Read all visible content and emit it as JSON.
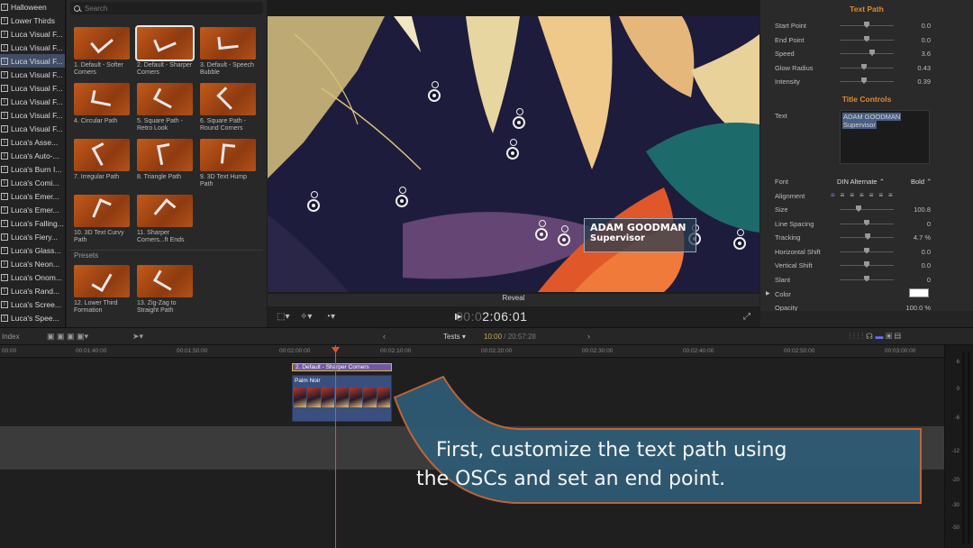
{
  "sidebar": {
    "items": [
      {
        "label": "Halloween",
        "selected": false
      },
      {
        "label": "Lower Thirds",
        "selected": false
      },
      {
        "label": "Luca Visual F...",
        "selected": false
      },
      {
        "label": "Luca Visual F...",
        "selected": false
      },
      {
        "label": "Luca Visual F...",
        "selected": true
      },
      {
        "label": "Luca Visual F...",
        "selected": false
      },
      {
        "label": "Luca Visual F...",
        "selected": false
      },
      {
        "label": "Luca Visual F...",
        "selected": false
      },
      {
        "label": "Luca Visual F...",
        "selected": false
      },
      {
        "label": "Luca Visual F...",
        "selected": false
      },
      {
        "label": "Luca's Asse...",
        "selected": false
      },
      {
        "label": "Luca's Auto-...",
        "selected": false
      },
      {
        "label": "Luca's Burn I...",
        "selected": false
      },
      {
        "label": "Luca's Comi...",
        "selected": false
      },
      {
        "label": "Luca's Emer...",
        "selected": false
      },
      {
        "label": "Luca's Emer...",
        "selected": false
      },
      {
        "label": "Luca's Falling...",
        "selected": false
      },
      {
        "label": "Luca's Fiery...",
        "selected": false
      },
      {
        "label": "Luca's Glass...",
        "selected": false
      },
      {
        "label": "Luca's Neon...",
        "selected": false
      },
      {
        "label": "Luca's Onom...",
        "selected": false
      },
      {
        "label": "Luca's Rand...",
        "selected": false
      },
      {
        "label": "Luca's Scree...",
        "selected": false
      },
      {
        "label": "Luca's Spee...",
        "selected": false
      }
    ]
  },
  "browser": {
    "search_placeholder": "Search",
    "tiles": [
      {
        "caption": "1. Default - Softer Corners",
        "selected": false
      },
      {
        "caption": "2. Default - Sharper Corners",
        "selected": true
      },
      {
        "caption": "3. Default - Speech Bubble",
        "selected": false
      },
      {
        "caption": "4. Circular Path",
        "selected": false
      },
      {
        "caption": "5. Square Path - Retro Look",
        "selected": false
      },
      {
        "caption": "6. Square Path - Round Corners",
        "selected": false
      },
      {
        "caption": "7. Irregular Path",
        "selected": false
      },
      {
        "caption": "8. Triangle Path",
        "selected": false
      },
      {
        "caption": "9. 3D Text Hump Path",
        "selected": false
      },
      {
        "caption": "10. 3D Text Curvy Path",
        "selected": false
      },
      {
        "caption": "11. Sharper Corners...ft Ends",
        "selected": false
      }
    ],
    "presets_label": "Presets",
    "preset_tiles": [
      {
        "caption": "12. Lower Third Formation"
      },
      {
        "caption": "13. Zig-Zag to Straight Path"
      }
    ]
  },
  "viewer": {
    "lower_third_name": "ADAM GOODMAN",
    "lower_third_title": "Supervisor",
    "effect_label": "Reveal",
    "timecode_dim": "00:0",
    "timecode": "2:06:01"
  },
  "inspector": {
    "text_path_title": "Text Path",
    "text_path_params": [
      {
        "label": "Start Point",
        "value": "0.0",
        "level": 0.5
      },
      {
        "label": "End Point",
        "value": "0.0",
        "level": 0.5
      },
      {
        "label": "Speed",
        "value": "3.6",
        "level": 0.6
      },
      {
        "label": "Glow Radius",
        "value": "0.43",
        "level": 0.45
      },
      {
        "label": "Intensity",
        "value": "0.39",
        "level": 0.45
      }
    ],
    "title_controls_title": "Title Controls",
    "text_label": "Text",
    "text_line1": "ADAM GOODMAN",
    "text_line2": "Supervisor",
    "font_label": "Font",
    "font_value": "DIN Alternate",
    "font_weight": "Bold",
    "alignment_label": "Alignment",
    "title_params": [
      {
        "label": "Size",
        "value": "100.8",
        "level": 0.35
      },
      {
        "label": "Line Spacing",
        "value": "0",
        "level": 0.5
      },
      {
        "label": "Tracking",
        "value": "4.7 %",
        "level": 0.52
      },
      {
        "label": "Horizontal Shift",
        "value": "0.0",
        "level": 0.5
      },
      {
        "label": "Vertical Shift",
        "value": "0.0",
        "level": 0.5
      },
      {
        "label": "Slant",
        "value": "0",
        "level": 0.5
      }
    ],
    "color_label": "Color",
    "opacity_label": "Opacity",
    "opacity_value": "100.0 %"
  },
  "timeline_toolbar": {
    "index_label": "Index",
    "project_name": "Tests",
    "tc_current": "10:00",
    "tc_total": " / 20:57:28"
  },
  "timeline": {
    "ruler_ticks": [
      "00:00",
      "00:01:40:00",
      "00:01:50:00",
      "00:02:00:00",
      "00:02:10:00",
      "00:02:20:00",
      "00:02:30:00",
      "00:02:40:00",
      "00:02:50:00",
      "00:03:00:00"
    ],
    "title_clip": "2. Default - Sharper Corners",
    "video_clip": "Palm Noir"
  },
  "meters": {
    "labels": [
      "6",
      "0",
      "-6",
      "-12",
      "-20",
      "-30",
      "-50"
    ]
  },
  "callout": {
    "line1": "First, customize the text path using",
    "line2": "the OSCs and set an end point.",
    "color": "#2e5b73",
    "border_color": "#c4683a"
  },
  "colors": {
    "accent_orange": "#e08a2a",
    "playhead": "#e0502a"
  }
}
